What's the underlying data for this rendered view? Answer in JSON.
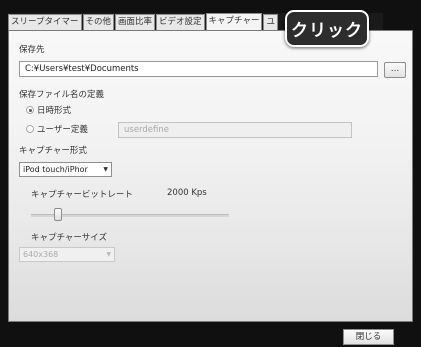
{
  "tabs": [
    {
      "label": "スリープタイマー"
    },
    {
      "label": "その他"
    },
    {
      "label": "画面比率"
    },
    {
      "label": "ビデオ設定"
    },
    {
      "label": "キャプチャー"
    },
    {
      "label": "ユ"
    }
  ],
  "callout": {
    "text": "クリック"
  },
  "save_location": {
    "label": "保存先",
    "path": "C:¥Users¥test¥Documents",
    "browse_label": "..."
  },
  "filename": {
    "section_label": "保存ファイル名の定義",
    "option_datetime": "日時形式",
    "option_user": "ユーザー定義",
    "user_value": "userdefine",
    "selected": "日時形式"
  },
  "capture_format": {
    "label": "キャプチャー形式",
    "value": "iPod touch/iPhor"
  },
  "bitrate": {
    "label": "キャプチャービットレート",
    "value_text": "2000 Kps",
    "slider_fraction": 0.12
  },
  "capture_size": {
    "label": "キャプチャーサイズ",
    "value": "640x368"
  },
  "footer": {
    "close_label": "閉じる"
  }
}
